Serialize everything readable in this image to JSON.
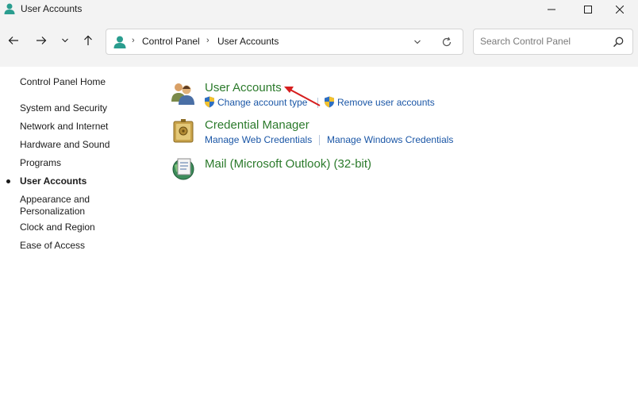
{
  "window": {
    "title": "User Accounts"
  },
  "address": {
    "crumbs": [
      "Control Panel",
      "User Accounts"
    ]
  },
  "search": {
    "placeholder": "Search Control Panel"
  },
  "sidebar": {
    "home": "Control Panel Home",
    "items": [
      {
        "label": "System and Security",
        "active": false
      },
      {
        "label": "Network and Internet",
        "active": false
      },
      {
        "label": "Hardware and Sound",
        "active": false
      },
      {
        "label": "Programs",
        "active": false
      },
      {
        "label": "User Accounts",
        "active": true
      },
      {
        "label": "Appearance and Personalization",
        "active": false
      },
      {
        "label": "Clock and Region",
        "active": false
      },
      {
        "label": "Ease of Access",
        "active": false
      }
    ]
  },
  "categories": [
    {
      "title": "User Accounts",
      "icon": "users-icon",
      "links": [
        "Change account type",
        "Remove user accounts"
      ]
    },
    {
      "title": "Credential Manager",
      "icon": "credential-vault-icon",
      "links": [
        "Manage Web Credentials",
        "Manage Windows Credentials"
      ]
    },
    {
      "title": "Mail (Microsoft Outlook) (32-bit)",
      "icon": "mail-globe-icon",
      "links": []
    }
  ],
  "colors": {
    "category_title": "#2b7a2b",
    "link": "#1a56a6",
    "annotation_arrow": "#d61f1f",
    "chrome_bg": "#f3f3f3"
  }
}
